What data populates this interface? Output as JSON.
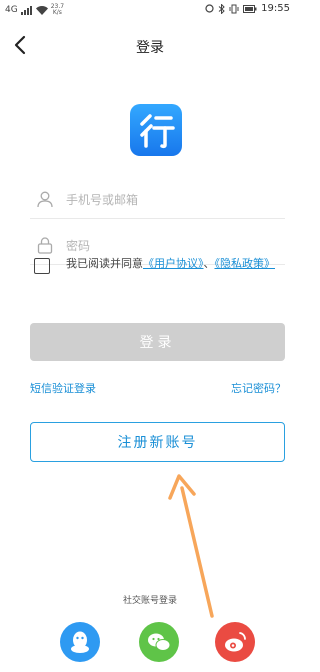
{
  "status_bar": {
    "network": "4G",
    "speed": "23.7",
    "speed_unit": "K/s",
    "time": "19:55",
    "battery_icon": "battery-icon",
    "bluetooth_icon": "bluetooth-icon"
  },
  "header": {
    "title": "登录",
    "back_icon": "chevron-left-icon"
  },
  "logo": {
    "char": "行",
    "color": "#1e88ee"
  },
  "phone_field": {
    "placeholder": "手机号或邮箱",
    "value": ""
  },
  "password_field": {
    "placeholder": "密码",
    "value": ""
  },
  "agreement": {
    "prefix": "我已阅读并同意",
    "user_agreement": "《用户协议》",
    "separator": "、",
    "privacy_policy": "《隐私政策》"
  },
  "buttons": {
    "login": "登录",
    "sms_login": "短信验证登录",
    "forgot_password": "忘记密码？",
    "register": "注册新账号"
  },
  "social": {
    "label": "社交账号登录",
    "items": [
      "qq-icon",
      "wechat-icon",
      "weibo-icon"
    ]
  },
  "colors": {
    "accent": "#1a8fd6",
    "login_disabled": "#cfcfcf",
    "arrow": "#f7a65a"
  }
}
